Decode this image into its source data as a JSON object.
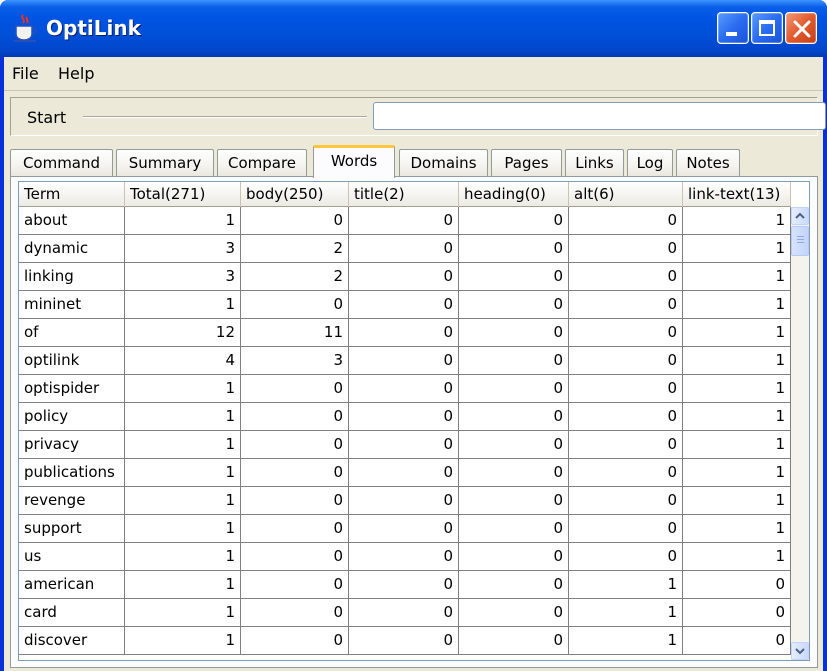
{
  "window": {
    "title": "OptiLink"
  },
  "menu": {
    "file": "File",
    "help": "Help"
  },
  "start": {
    "label": "Start",
    "value": ""
  },
  "tabs": [
    "Command",
    "Summary",
    "Compare",
    "Words",
    "Domains",
    "Pages",
    "Links",
    "Log",
    "Notes"
  ],
  "active_tab": "Words",
  "table": {
    "columns": [
      "Term",
      "Total(271)",
      "body(250)",
      "title(2)",
      "heading(0)",
      "alt(6)",
      "link-text(13)"
    ],
    "rows": [
      [
        "about",
        "1",
        "0",
        "0",
        "0",
        "0",
        "1"
      ],
      [
        "dynamic",
        "3",
        "2",
        "0",
        "0",
        "0",
        "1"
      ],
      [
        "linking",
        "3",
        "2",
        "0",
        "0",
        "0",
        "1"
      ],
      [
        "mininet",
        "1",
        "0",
        "0",
        "0",
        "0",
        "1"
      ],
      [
        "of",
        "12",
        "11",
        "0",
        "0",
        "0",
        "1"
      ],
      [
        "optilink",
        "4",
        "3",
        "0",
        "0",
        "0",
        "1"
      ],
      [
        "optispider",
        "1",
        "0",
        "0",
        "0",
        "0",
        "1"
      ],
      [
        "policy",
        "1",
        "0",
        "0",
        "0",
        "0",
        "1"
      ],
      [
        "privacy",
        "1",
        "0",
        "0",
        "0",
        "0",
        "1"
      ],
      [
        "publications",
        "1",
        "0",
        "0",
        "0",
        "0",
        "1"
      ],
      [
        "revenge",
        "1",
        "0",
        "0",
        "0",
        "0",
        "1"
      ],
      [
        "support",
        "1",
        "0",
        "0",
        "0",
        "0",
        "1"
      ],
      [
        "us",
        "1",
        "0",
        "0",
        "0",
        "0",
        "1"
      ],
      [
        "american",
        "1",
        "0",
        "0",
        "0",
        "1",
        "0"
      ],
      [
        "card",
        "1",
        "0",
        "0",
        "0",
        "1",
        "0"
      ],
      [
        "discover",
        "1",
        "0",
        "0",
        "0",
        "1",
        "0"
      ]
    ]
  },
  "colors": {
    "title_bar": "#0054e3",
    "close_button": "#e25a2e",
    "active_tab_accent": "#ffc73c",
    "client_bg": "#ece9d8"
  },
  "icons": [
    "java-cup-icon",
    "minimize-icon",
    "maximize-icon",
    "close-icon",
    "scroll-up-icon",
    "scroll-down-icon"
  ]
}
